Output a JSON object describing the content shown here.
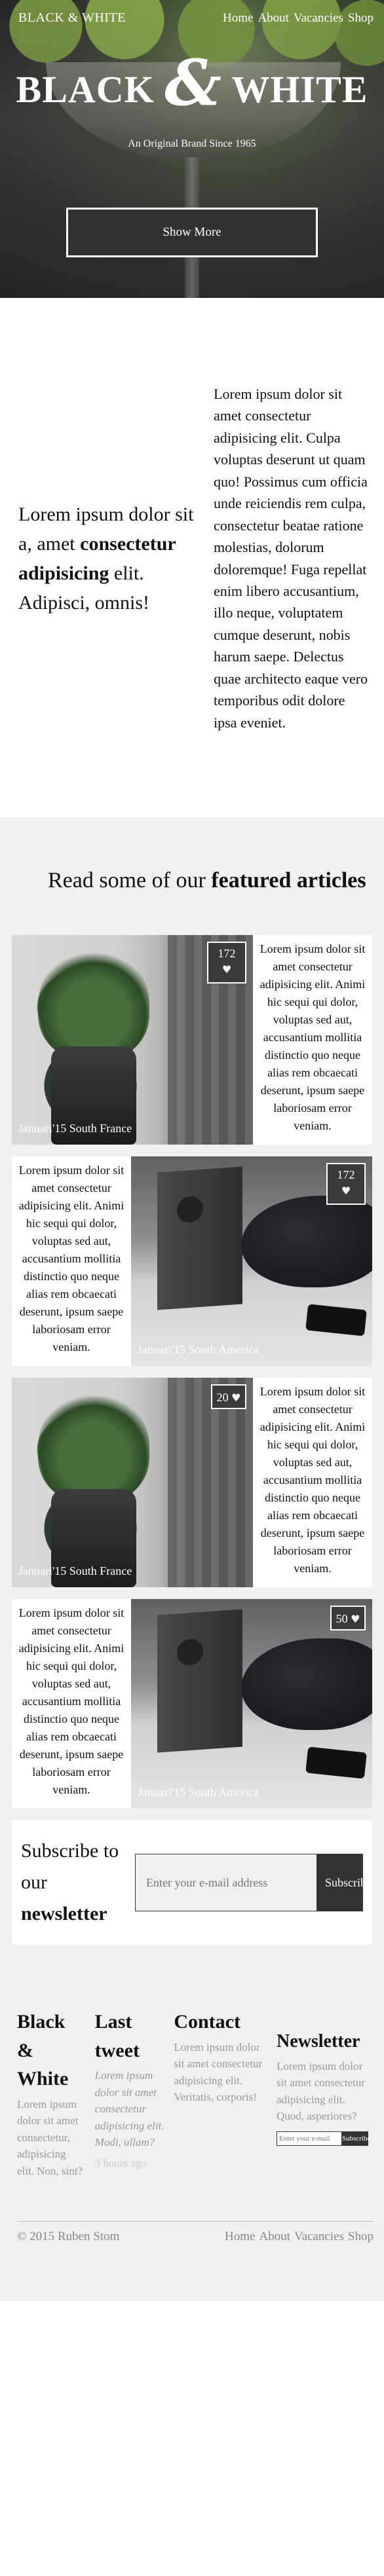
{
  "header": {
    "brand": "BLACK & WHITE",
    "nav": [
      "Home",
      "About",
      "Vacancies",
      "Shop"
    ]
  },
  "hero": {
    "title_left": "BLACK",
    "title_amp": "&",
    "title_right": "WHITE",
    "tagline": "An Original Brand Since 1965",
    "button": "Show More"
  },
  "intro": {
    "left_pre": "Lorem ipsum dolor sit a, amet ",
    "left_bold": "consectetur adipisicing",
    "left_post": " elit. Adipisci, omnis!",
    "right": "Lorem ipsum dolor sit amet consectetur adipisicing elit. Culpa voluptas deserunt ut quam quo! Possimus cum officia unde reiciendis rem culpa, consectetur beatae ratione molestias, dolorum doloremque! Fuga repellat enim libero accusantium, illo neque, voluptatem cumque deserunt, nobis harum saepe. Delectus quae architecto eaque vero temporibus odit dolore ipsa eveniet."
  },
  "featured": {
    "title_pre": "Read some of our ",
    "title_bold": "featured articles",
    "heart_icon": "heart-icon",
    "articles": [
      {
        "likes": "172",
        "caption": "Januari'15 South France",
        "text": "Lorem ipsum dolor sit amet consectetur adipisicing elit. Animi hic sequi qui dolor, voluptas sed aut, accusantium mollitia distinctio quo neque alias rem obcaecati deserunt, ipsum saepe laboriosam error veniam."
      },
      {
        "likes": "172",
        "caption": "Januari'15 South America",
        "text": "Lorem ipsum dolor sit amet consectetur adipisicing elit. Animi hic sequi qui dolor, voluptas sed aut, accusantium mollitia distinctio quo neque alias rem obcaecati deserunt, ipsum saepe laboriosam error veniam."
      },
      {
        "likes": "20",
        "caption": "Januari'15 South France",
        "text": "Lorem ipsum dolor sit amet consectetur adipisicing elit. Animi hic sequi qui dolor, voluptas sed aut, accusantium mollitia distinctio quo neque alias rem obcaecati deserunt, ipsum saepe laboriosam error veniam."
      },
      {
        "likes": "50",
        "caption": "Januari'15 South America",
        "text": "Lorem ipsum dolor sit amet consectetur adipisicing elit. Animi hic sequi qui dolor, voluptas sed aut, accusantium mollitia distinctio quo neque alias rem obcaecati deserunt, ipsum saepe laboriosam error veniam."
      }
    ]
  },
  "subscribe": {
    "title_pre": "Subscribe to our ",
    "title_bold": "newsletter",
    "placeholder": "Enter your e-mail address",
    "button": "Subscribe"
  },
  "footer": {
    "col1_title": "Black & White",
    "col1_text": "Lorem ipsum dolor sit amet consectetur, adipisicing elit. Non, sint?",
    "col2_title": "Last tweet",
    "col2_text": "Lorem ipsum dolor sit amet consectetur adipisicing elit. Modi, ullam?",
    "col2_time": "3 hours ago",
    "col3_title": "Contact",
    "col3_text": "Lorem ipsum dolor sit amet consectetur adipisicing elit. Veritatis, corporis!",
    "col4_title": "Newsletter",
    "col4_text": "Lorem ipsum dolor sit amet consectetur adipisicing elit. Quod, asperiores?",
    "col4_placeholder": "Enter your e-mail",
    "col4_button": "Subscribe",
    "copyright": "© 2015 Ruben Stom",
    "links": [
      "Home",
      "About",
      "Vacancies",
      "Shop"
    ]
  }
}
